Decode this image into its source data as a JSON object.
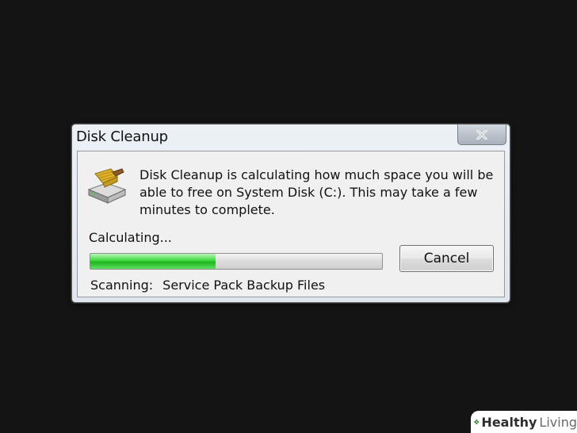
{
  "dialog": {
    "title": "Disk Cleanup",
    "close_label": "close",
    "message": "Disk Cleanup is calculating how much space you will be able to free on System Disk (C:). This may take a few minutes to complete.",
    "status_text": "Calculating...",
    "progress_fraction": 0.43,
    "cancel_label": "Cancel",
    "scanning_label": "Scanning:",
    "scanning_item": "Service Pack Backup Files"
  },
  "watermark": {
    "brand_a": "Healthy",
    "brand_b": "Living",
    "plus_color": "#3b8b3f"
  },
  "icons": {
    "close": "close-icon",
    "disk": "disk-cleanup-icon",
    "brand": "plus-logo-icon"
  }
}
